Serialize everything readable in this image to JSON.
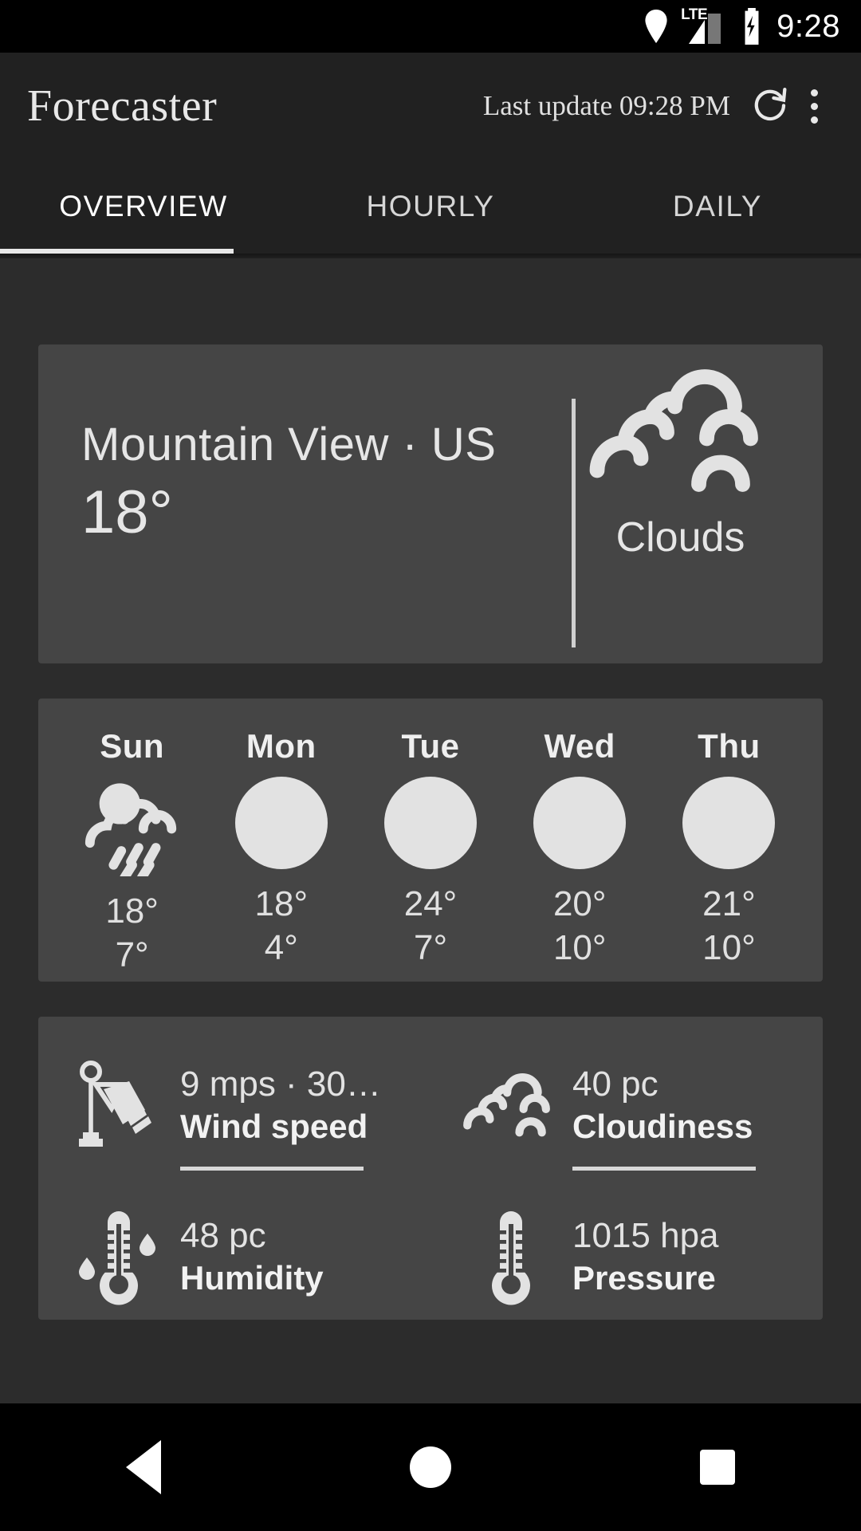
{
  "statusbar": {
    "network_label": "LTE",
    "time": "9:28",
    "icons": [
      "location-pin-icon",
      "lte-signal-icon",
      "battery-charging-icon"
    ]
  },
  "appbar": {
    "title": "Forecaster",
    "last_update": "Last update 09:28 PM",
    "refresh_icon": "refresh-icon",
    "overflow_icon": "overflow-menu-icon"
  },
  "tabs": {
    "items": [
      {
        "label": "OVERVIEW",
        "active": true
      },
      {
        "label": "HOURLY",
        "active": false
      },
      {
        "label": "DAILY",
        "active": false
      }
    ]
  },
  "current": {
    "city": "Mountain View · US",
    "temperature": "18°",
    "condition": "Clouds",
    "condition_icon": "clouds-icon"
  },
  "daily": [
    {
      "day": "Sun",
      "icon": "rain-cloud-icon",
      "high": "18°",
      "low": "7°"
    },
    {
      "day": "Mon",
      "icon": "circle-placeholder-icon",
      "high": "18°",
      "low": "4°"
    },
    {
      "day": "Tue",
      "icon": "circle-placeholder-icon",
      "high": "24°",
      "low": "7°"
    },
    {
      "day": "Wed",
      "icon": "circle-placeholder-icon",
      "high": "20°",
      "low": "10°"
    },
    {
      "day": "Thu",
      "icon": "circle-placeholder-icon",
      "high": "21°",
      "low": "10°"
    }
  ],
  "details": [
    {
      "value": "9 mps · 30…",
      "label": "Wind speed",
      "icon": "windsock-icon"
    },
    {
      "value": "40 pc",
      "label": "Cloudiness",
      "icon": "cloud-outline-icon"
    },
    {
      "value": "48 pc",
      "label": "Humidity",
      "icon": "thermometer-humidity-icon"
    },
    {
      "value": "1015 hpa",
      "label": "Pressure",
      "icon": "thermometer-icon"
    }
  ],
  "navbar": {
    "back": "back-button",
    "home": "home-button",
    "recents": "recents-button"
  },
  "colors": {
    "status_bar": "#000000",
    "app_bar": "#212121",
    "content_bg": "#2c2c2c",
    "card_bg": "#454545",
    "text_primary": "#e8e8e8",
    "accent": "#e8e8e8"
  }
}
